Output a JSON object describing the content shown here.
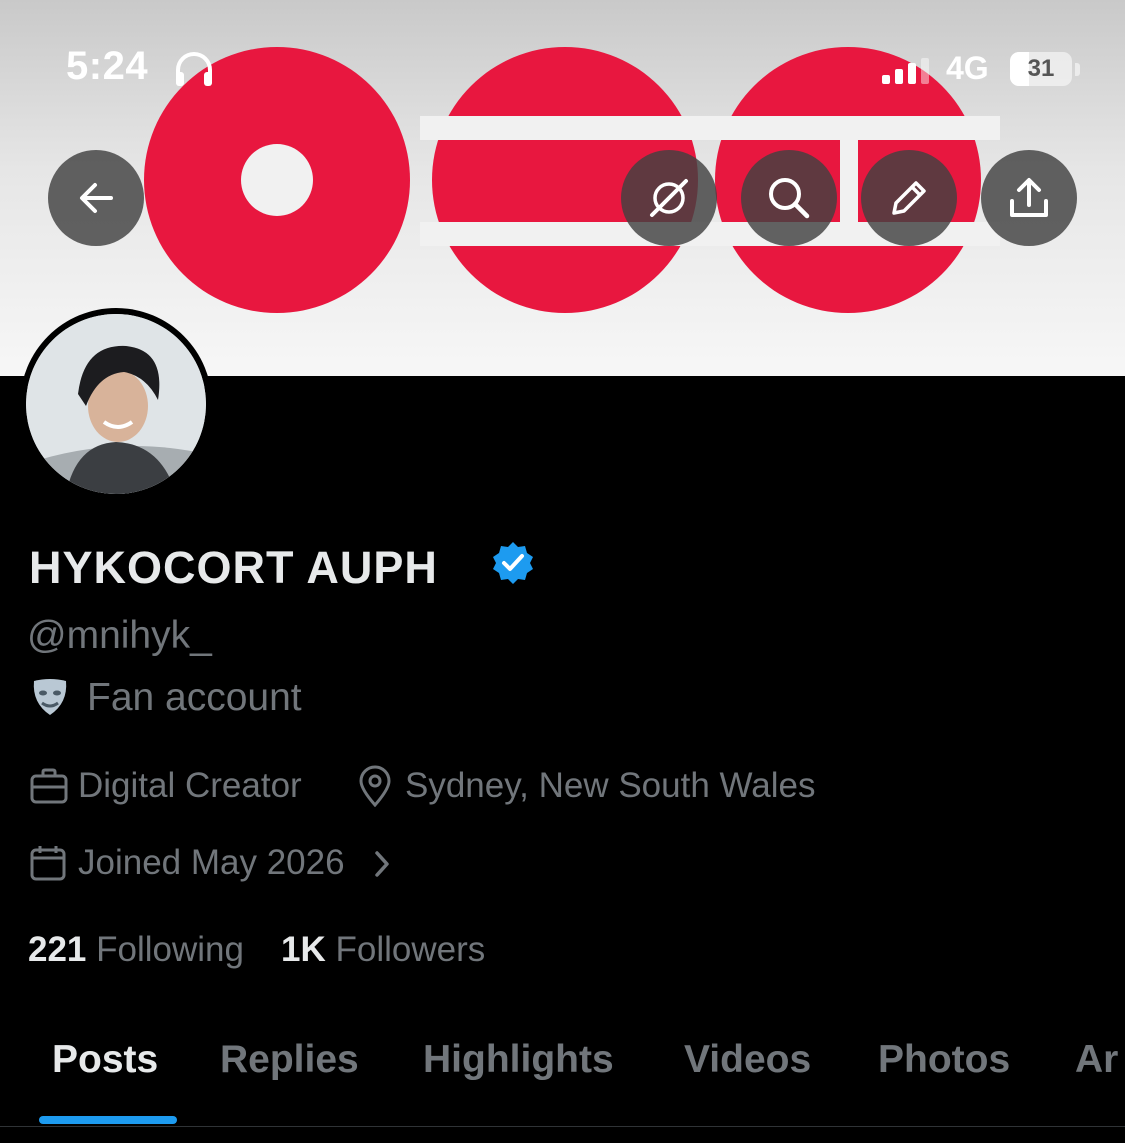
{
  "status_bar": {
    "time": "5:24",
    "network": "4G",
    "battery": "31",
    "battery_fraction": 0.31,
    "headphones_icon": "headphones-icon",
    "signal_icon": "cellular-signal-icon"
  },
  "header_actions": {
    "back_icon": "arrow-left-icon",
    "grok_icon": "grok-icon",
    "search_icon": "search-icon",
    "edit_icon": "pencil-icon",
    "share_icon": "share-icon"
  },
  "profile": {
    "display_name": "HYKOCORT AUPH",
    "verified_icon": "verified-badge-icon",
    "handle": "@mnihyk_",
    "category_icon": "theater-masks-icon",
    "category": "Fan account",
    "profession_icon": "briefcase-icon",
    "profession": "Digital Creator",
    "location_icon": "location-pin-icon",
    "location": "Sydney, New South Wales",
    "joined_icon": "calendar-icon",
    "joined": "Joined May 2026",
    "joined_chevron_icon": "chevron-right-icon"
  },
  "stats": {
    "following_count": "221",
    "following_label": "Following",
    "followers_count": "1K",
    "followers_label": "Followers"
  },
  "tabs": [
    {
      "label": "Posts",
      "active": true
    },
    {
      "label": "Replies",
      "active": false
    },
    {
      "label": "Highlights",
      "active": false
    },
    {
      "label": "Videos",
      "active": false
    },
    {
      "label": "Photos",
      "active": false
    },
    {
      "label": "Ar",
      "active": false
    }
  ],
  "colors": {
    "accent": "#1d9bf0",
    "banner_logo_red": "#e8173f",
    "text_primary": "#e7e9ea",
    "text_secondary": "#71767b",
    "background": "#000000"
  }
}
